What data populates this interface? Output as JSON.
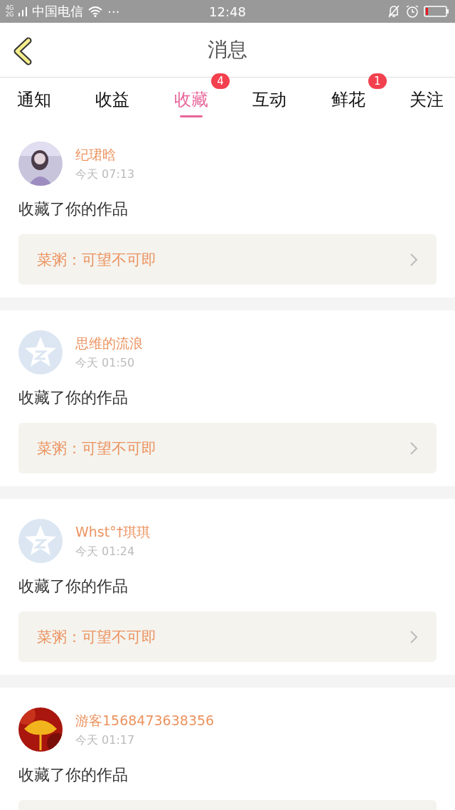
{
  "status_bar": {
    "network_top": "4G",
    "network_bottom": "2G",
    "carrier": "中国电信",
    "more": "···",
    "time": "12:48"
  },
  "header": {
    "title": "消息"
  },
  "tabs": [
    {
      "label": "通知",
      "selected": false
    },
    {
      "label": "收益",
      "selected": false
    },
    {
      "label": "收藏",
      "selected": true,
      "badge": "4"
    },
    {
      "label": "互动",
      "selected": false
    },
    {
      "label": "鲜花",
      "selected": false,
      "badge": "1"
    },
    {
      "label": "关注",
      "selected": false
    }
  ],
  "messages": [
    {
      "avatar": {
        "kind": "portrait"
      },
      "name": "纪珺晗",
      "time": "今天 07:13",
      "action": "收藏了你的作品",
      "work": "菜粥：可望不可即"
    },
    {
      "avatar": {
        "kind": "default"
      },
      "name": "思维的流浪",
      "time": "今天 01:50",
      "action": "收藏了你的作品",
      "work": "菜粥：可望不可即"
    },
    {
      "avatar": {
        "kind": "default"
      },
      "name": "Whst°†琪琪",
      "time": "今天 01:24",
      "action": "收藏了你的作品",
      "work": "菜粥：可望不可即"
    },
    {
      "avatar": {
        "kind": "leaf"
      },
      "name": "游客1568473638356",
      "time": "今天 01:17",
      "action": "收藏了你的作品"
    }
  ]
}
